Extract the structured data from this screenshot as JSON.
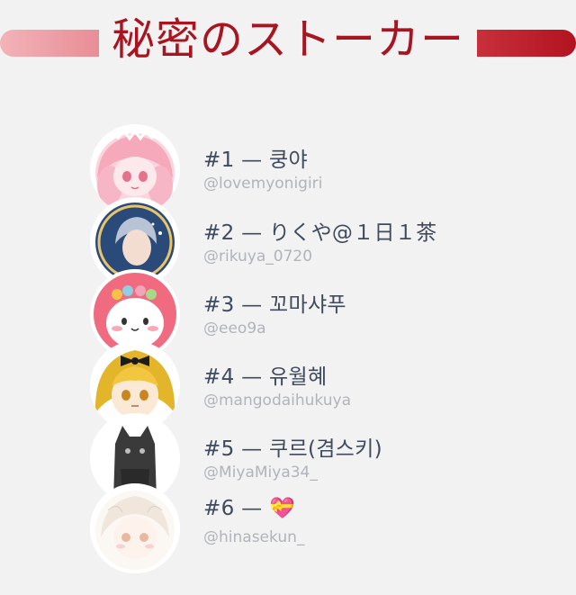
{
  "header": {
    "title": "秘密のストーカー"
  },
  "entries": [
    {
      "label": "#1 — 쿵야",
      "handle": "@lovemyonigiri"
    },
    {
      "label": "#2 — りくや@１日１茶",
      "handle": "@rikuya_0720"
    },
    {
      "label": "#3 — 꼬마샤푸",
      "handle": "@eeo9a"
    },
    {
      "label": "#4 — 유월혜",
      "handle": "@mangodaihukuya"
    },
    {
      "label": "#5 — 쿠르(겸스키)",
      "handle": "@MiyaMiya34_"
    },
    {
      "label": "#6 — 💝",
      "handle": "@hinasekun_"
    }
  ],
  "colors": {
    "title": "#a8141f",
    "bar_left": "#e88d96",
    "bar_right": "#b21320",
    "name_text": "#3f4a5e",
    "handle_text": "#b0b4ba",
    "background": "#f2f2f2"
  }
}
